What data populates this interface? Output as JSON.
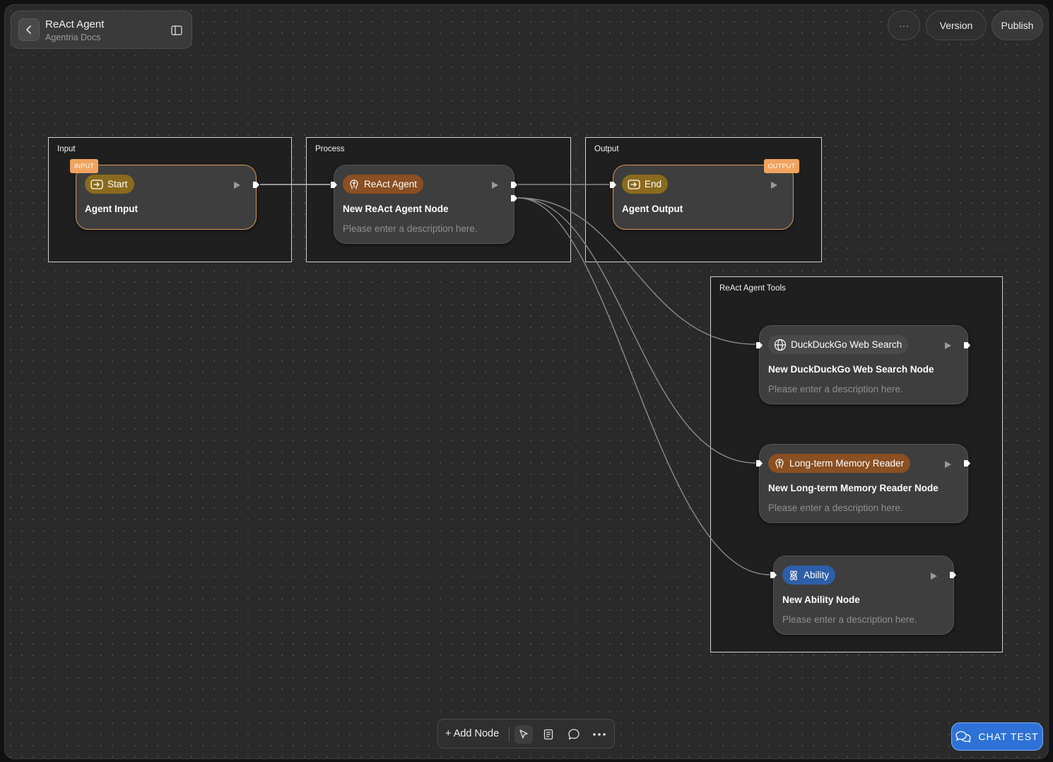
{
  "header": {
    "title": "ReAct Agent",
    "subtitle": "Agentria Docs"
  },
  "top_actions": {
    "more": "···",
    "version": "Version",
    "publish": "Publish"
  },
  "groups": {
    "input": "Input",
    "process": "Process",
    "output": "Output",
    "tools": "ReAct Agent Tools"
  },
  "nodes": {
    "start": {
      "tag": "INPUT",
      "pill": "Start",
      "title": "Agent Input"
    },
    "react": {
      "pill": "ReAct Agent",
      "title": "New ReAct Agent Node",
      "desc": "Please enter a description here."
    },
    "end": {
      "tag": "OUTPUT",
      "pill": "End",
      "title": "Agent Output"
    },
    "duckduckgo": {
      "pill": "DuckDuckGo Web Search",
      "title": "New DuckDuckGo Web Search Node",
      "desc": "Please enter a description here."
    },
    "memory": {
      "pill": "Long-term Memory Reader",
      "title": "New Long-term Memory Reader Node",
      "desc": "Please enter a description here."
    },
    "ability": {
      "pill": "Ability",
      "title": "New Ability Node",
      "desc": "Please enter a description here."
    }
  },
  "colors": {
    "io_pill": "#8a6a1c",
    "agent_pill": "#8a4f22",
    "tool_pill": "#4a4a4a",
    "ability_pill": "#2d5fa8",
    "io_border": "#d49a55",
    "tag": "#f0a35e",
    "chat_button": "#2e72d8"
  },
  "toolbar": {
    "add_node": "+ Add Node"
  },
  "chat": {
    "label": "CHAT TEST"
  }
}
